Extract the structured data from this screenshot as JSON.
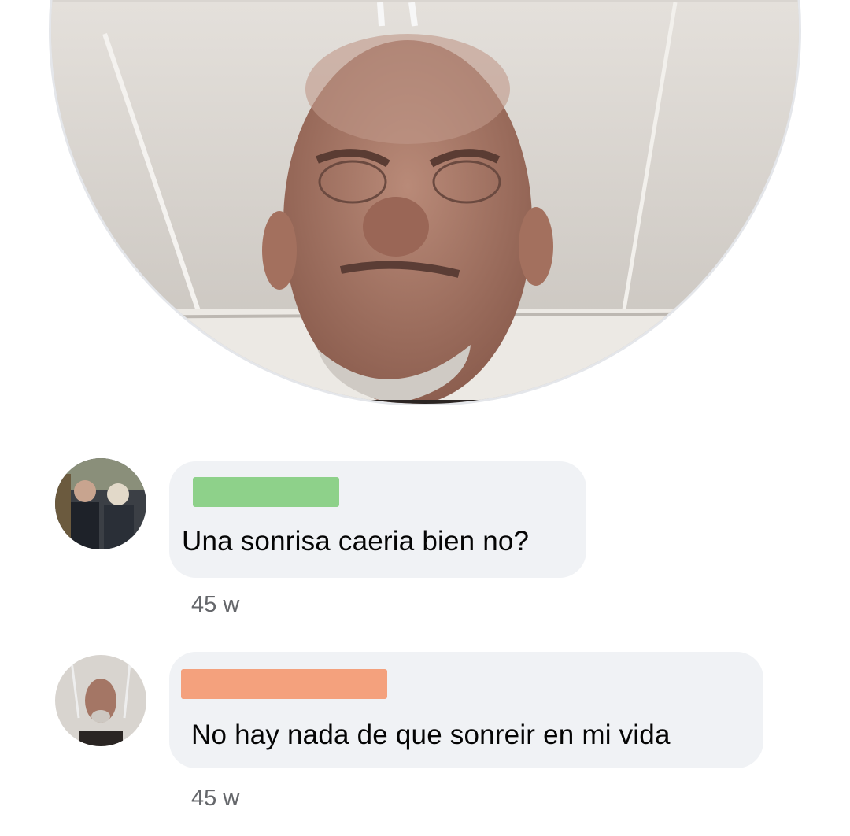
{
  "comments": [
    {
      "author_redacted_color": "#8ed18a",
      "text": "Una sonrisa caeria bien no?",
      "time": "45 w"
    },
    {
      "author_redacted_color": "#f4a17d",
      "text": "No hay nada de que sonreir en mi vida",
      "time": "45 w"
    }
  ]
}
